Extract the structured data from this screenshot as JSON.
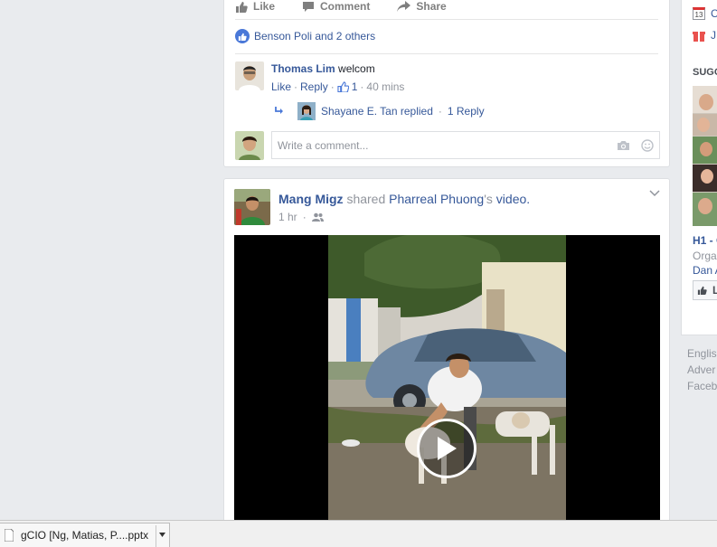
{
  "post1": {
    "actions": {
      "like": "Like",
      "comment": "Comment",
      "share": "Share"
    },
    "likes_text": "Benson Poli and 2 others",
    "comment": {
      "author": "Thomas Lim",
      "text": "welcom",
      "like_label": "Like",
      "reply_label": "Reply",
      "like_count": "1",
      "time": "40 mins",
      "sep": "·"
    },
    "reply_summary": {
      "text": "Shayane E. Tan replied",
      "count": "1 Reply"
    },
    "write_placeholder": "Write a comment..."
  },
  "post2": {
    "author": "Mang Migz",
    "shared_word": "shared",
    "source": "Pharreal Phuong",
    "source_suffix": "'s",
    "object": "video.",
    "time": "1 hr",
    "sep": "·"
  },
  "right_col": {
    "calendar_day": "13",
    "row1": "C",
    "row2": "J",
    "suggested": "SUGG",
    "page_title": "H1 - C",
    "page_sub": "Organ",
    "page_friend": "Dan A",
    "like_btn": "L"
  },
  "footer": {
    "l1": "Englis",
    "l2": "Adver",
    "l3": "Faceb"
  },
  "taskbar": {
    "file_label": "gCIO [Ng, Matias, P....pptx"
  },
  "colors": {
    "link": "#365899",
    "accent": "#4a78d8",
    "muted": "#90949c"
  }
}
